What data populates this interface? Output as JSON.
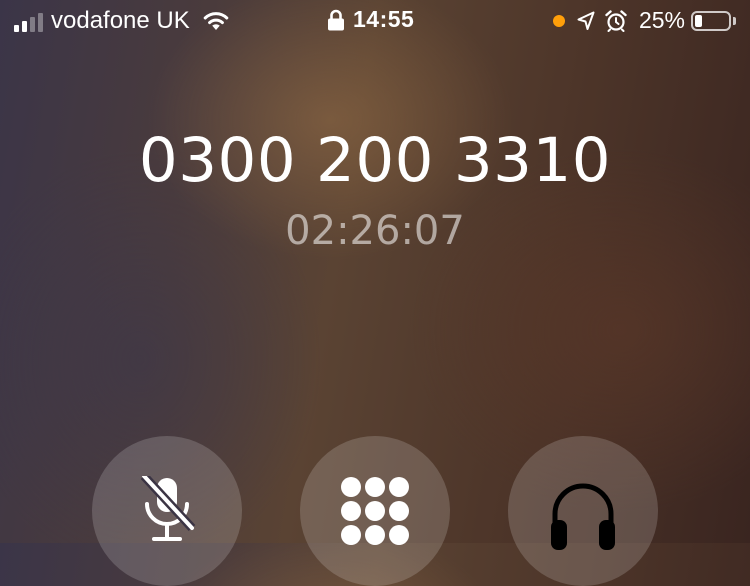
{
  "status_bar": {
    "carrier": "vodafone UK",
    "signal_bars_active": 2,
    "signal_bars_total": 4,
    "time": "14:55",
    "battery_percent": "25%",
    "battery_level": 0.25,
    "indicator_color": "#ff9f0a",
    "icons": [
      "wifi-icon",
      "lock-icon",
      "location-arrow-icon",
      "alarm-icon",
      "battery-icon"
    ]
  },
  "call": {
    "number": "0300 200 3310",
    "duration": "02:26:07"
  },
  "controls": [
    {
      "name": "mute",
      "icon": "microphone-slash-icon"
    },
    {
      "name": "keypad",
      "icon": "keypad-icon"
    },
    {
      "name": "audio",
      "icon": "headphones-icon"
    }
  ]
}
